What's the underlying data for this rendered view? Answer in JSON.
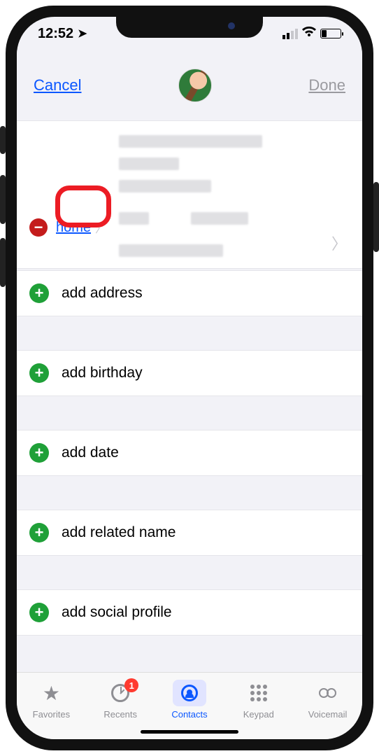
{
  "statusbar": {
    "time": "12:52"
  },
  "header": {
    "cancel": "Cancel",
    "done": "Done"
  },
  "address": {
    "label": "home"
  },
  "rows": {
    "add_address": "add address",
    "add_birthday": "add birthday",
    "add_date": "add date",
    "add_related": "add related name",
    "add_social": "add social profile"
  },
  "tabs": {
    "favorites": "Favorites",
    "recents": "Recents",
    "recents_badge": "1",
    "contacts": "Contacts",
    "keypad": "Keypad",
    "voicemail": "Voicemail"
  }
}
